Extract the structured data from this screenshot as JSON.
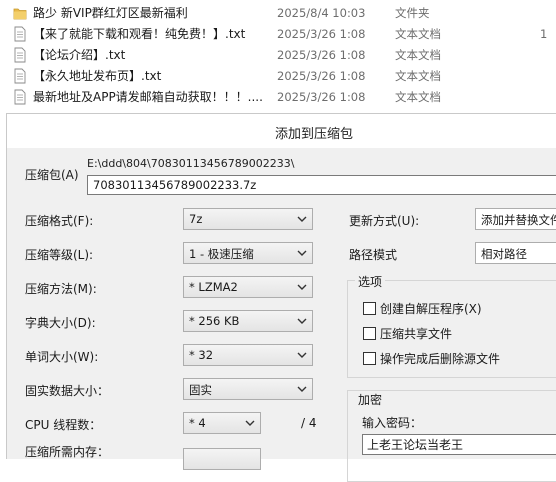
{
  "file_list": {
    "rows": [
      {
        "name": "路少 新VIP群红灯区最新福利",
        "date": "2025/8/4 10:03",
        "type": "文件夹",
        "extra": "",
        "icon": "folder-icon"
      },
      {
        "name": "【来了就能下载和观看！纯免费！】.txt",
        "date": "2025/3/26 1:08",
        "type": "文本文档",
        "extra": "1",
        "icon": "text-file-icon"
      },
      {
        "name": "【论坛介绍】.txt",
        "date": "2025/3/26 1:08",
        "type": "文本文档",
        "extra": "",
        "icon": "text-file-icon"
      },
      {
        "name": "【永久地址发布页】.txt",
        "date": "2025/3/26 1:08",
        "type": "文本文档",
        "extra": "",
        "icon": "text-file-icon"
      },
      {
        "name": "最新地址及APP请发邮箱自动获取！！！....",
        "date": "2025/3/26 1:08",
        "type": "文本文档",
        "extra": "",
        "icon": "text-file-icon"
      }
    ]
  },
  "dialog": {
    "title": "添加到压缩包",
    "archive": {
      "label": "压缩包(A)",
      "path": "E:\\ddd\\804\\70830113456789002233\\",
      "filename": "70830113456789002233.7z"
    },
    "left": {
      "format": {
        "label": "压缩格式(F):",
        "value": "7z"
      },
      "level": {
        "label": "压缩等级(L):",
        "value": "1 - 极速压缩"
      },
      "method": {
        "label": "压缩方法(M):",
        "value": "* LZMA2"
      },
      "dict_size": {
        "label": "字典大小(D):",
        "value": "* 256 KB"
      },
      "word_size": {
        "label": "单词大小(W):",
        "value": "* 32"
      },
      "solid_size": {
        "label": "固实数据大小：",
        "value": "固实"
      },
      "cpu_threads": {
        "label": "CPU 线程数：",
        "value": "* 4",
        "max": "/ 4"
      },
      "memory": {
        "label": "压缩所需内存："
      }
    },
    "right": {
      "update_mode": {
        "label": "更新方式(U):",
        "value": "添加并替换文件"
      },
      "path_mode": {
        "label": "路径模式",
        "value": "相对路径"
      },
      "options": {
        "title": "选项",
        "items": [
          {
            "label": "创建自解压程序(X)",
            "checked": false
          },
          {
            "label": "压缩共享文件",
            "checked": false
          },
          {
            "label": "操作完成后删除源文件",
            "checked": false
          }
        ]
      },
      "encryption": {
        "title": "加密",
        "password_label": "输入密码：",
        "password_value": "上老王论坛当老王"
      }
    }
  },
  "colors": {
    "dialog_bg": "#f0f0f0",
    "folder": "#e8b94a",
    "border": "#adadad"
  }
}
